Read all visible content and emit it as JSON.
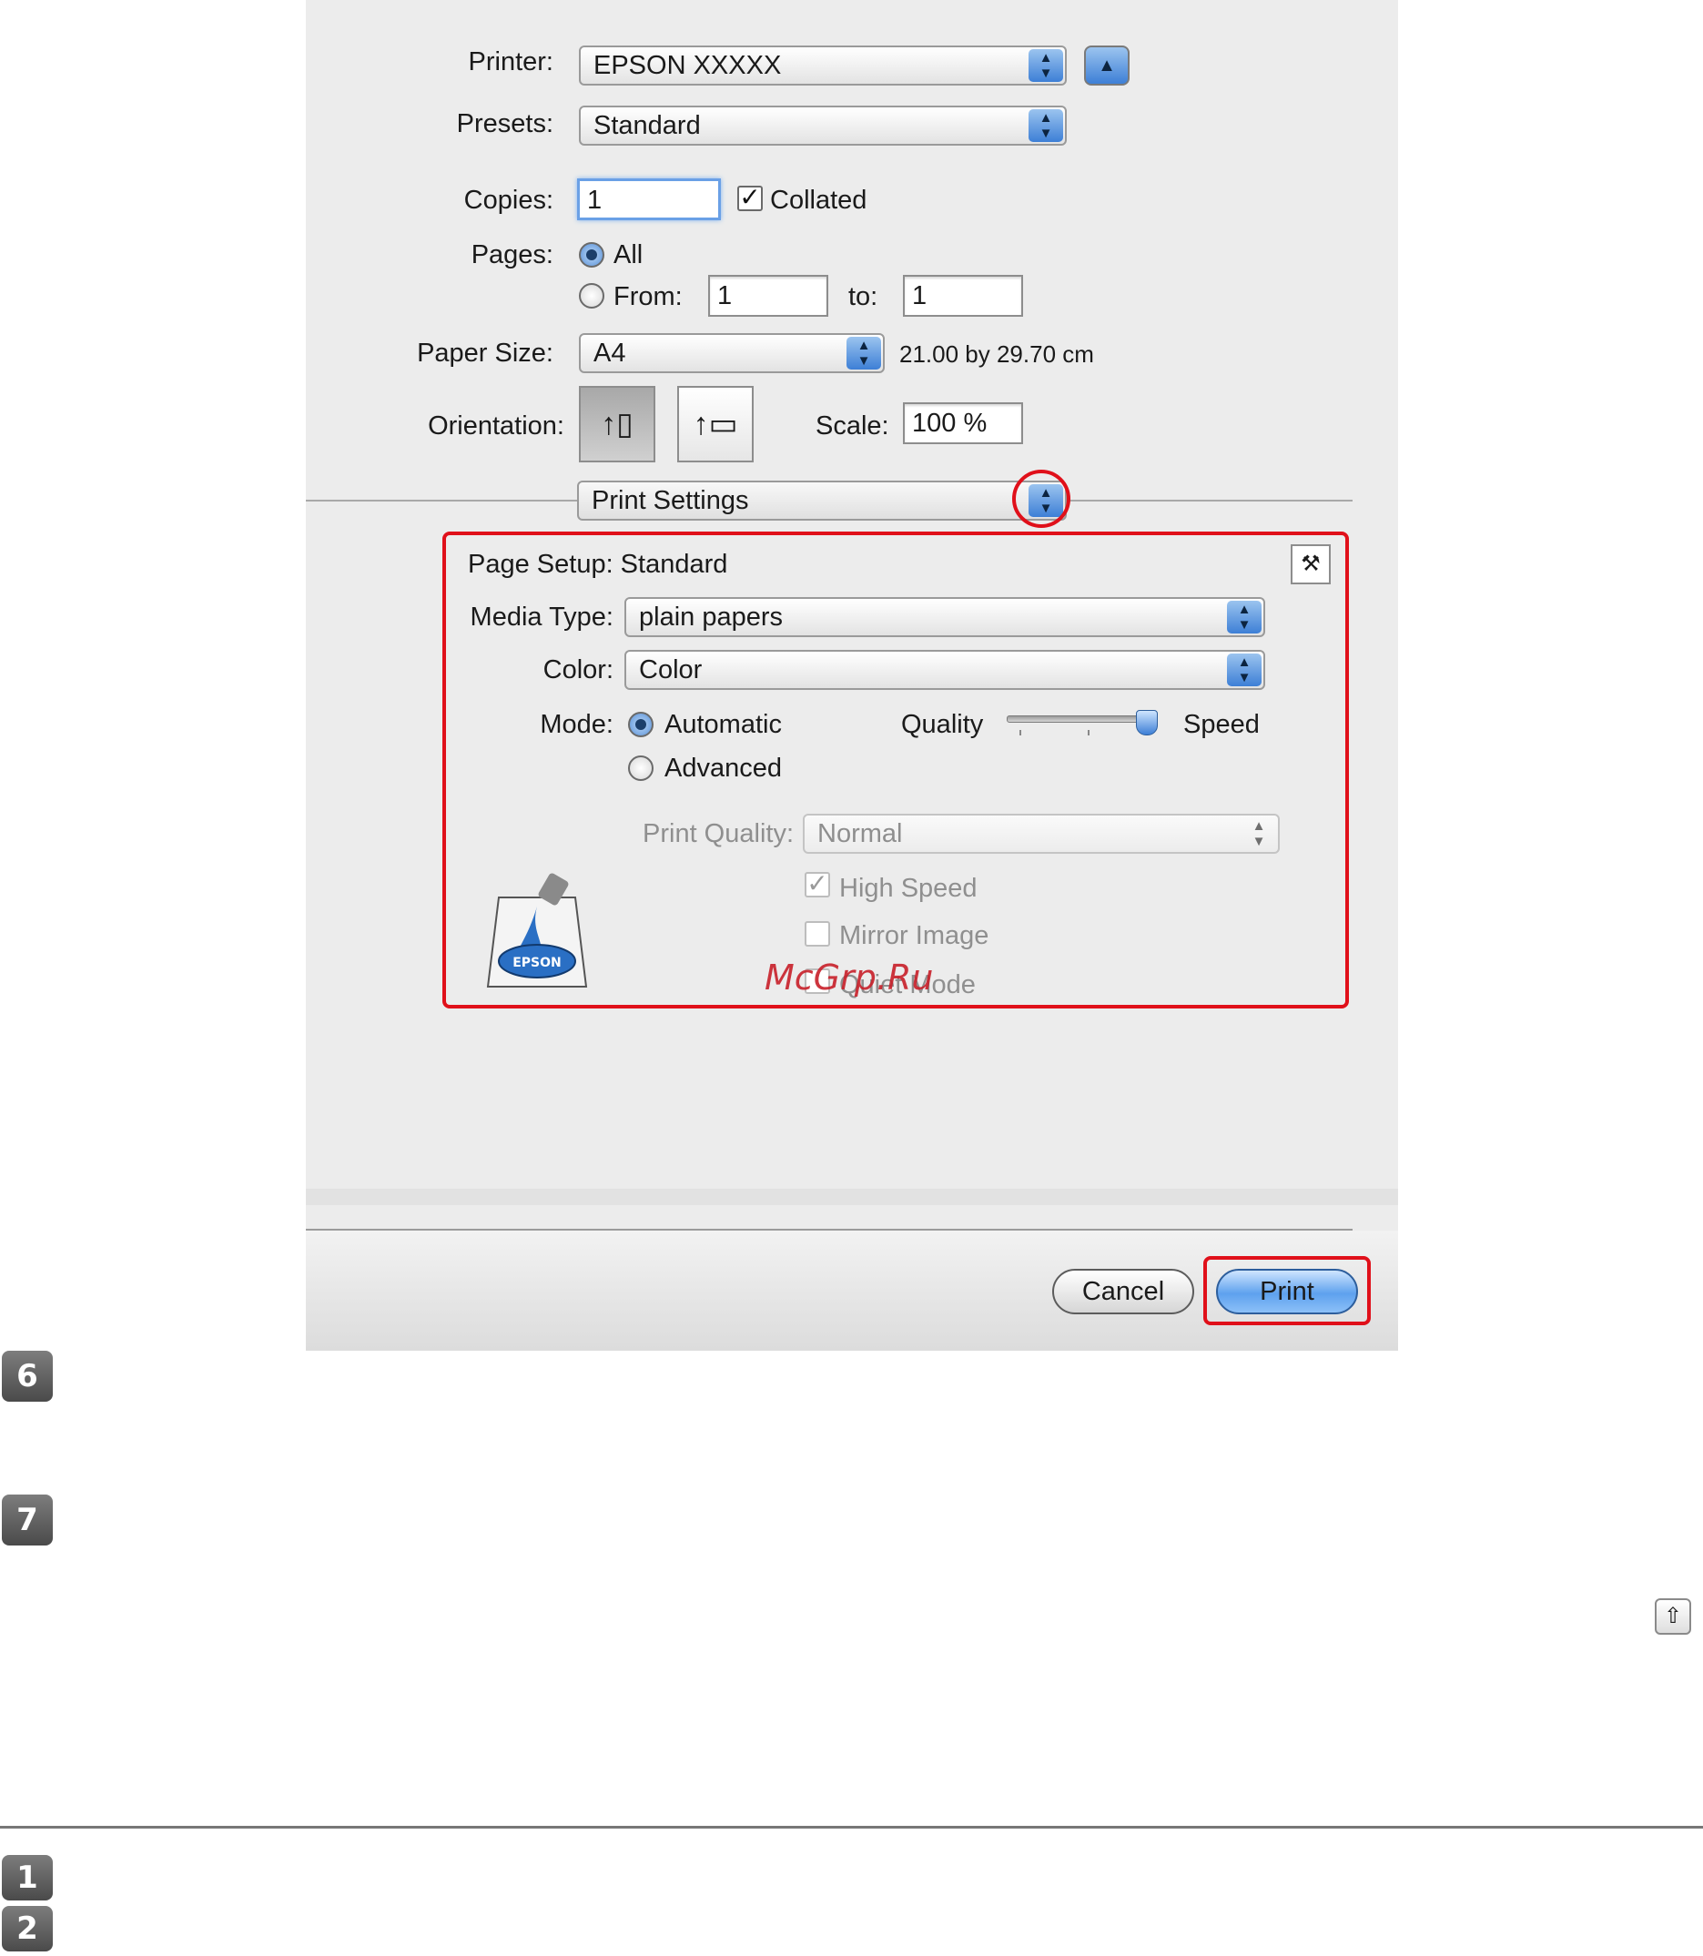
{
  "dialog": {
    "printer": {
      "label": "Printer:",
      "value": "EPSON XXXXX"
    },
    "presets": {
      "label": "Presets:",
      "value": "Standard"
    },
    "copies": {
      "label": "Copies:",
      "value": "1",
      "collated_label": "Collated",
      "collated_checked": true
    },
    "pages": {
      "label": "Pages:",
      "all_label": "All",
      "from_label": "From:",
      "from_value": "1",
      "to_label": "to:",
      "to_value": "1",
      "selected": "All"
    },
    "paper_size": {
      "label": "Paper Size:",
      "value": "A4",
      "dimensions": "21.00 by 29.70 cm"
    },
    "orientation": {
      "label": "Orientation:",
      "selected": "portrait"
    },
    "scale": {
      "label": "Scale:",
      "value": "100 %"
    },
    "panel_selector": {
      "value": "Print Settings"
    },
    "print_settings": {
      "page_setup": "Page Setup: Standard",
      "media_type": {
        "label": "Media Type:",
        "value": "plain papers"
      },
      "color": {
        "label": "Color:",
        "value": "Color"
      },
      "mode": {
        "label": "Mode:",
        "automatic_label": "Automatic",
        "advanced_label": "Advanced",
        "selected": "Automatic"
      },
      "slider": {
        "quality_label": "Quality",
        "speed_label": "Speed",
        "position": 1.0
      },
      "print_quality": {
        "label": "Print Quality:",
        "value": "Normal"
      },
      "high_speed_label": "High Speed",
      "mirror_image_label": "Mirror Image",
      "quiet_mode_label": "Quiet Mode",
      "logo_text": "EPSON"
    },
    "buttons": {
      "cancel": "Cancel",
      "print": "Print"
    }
  },
  "watermark": "McGrp.Ru",
  "steps": [
    "6",
    "7",
    "1",
    "2"
  ],
  "colors": {
    "highlight": "#e0101a",
    "accent": "#3d7fd6"
  }
}
